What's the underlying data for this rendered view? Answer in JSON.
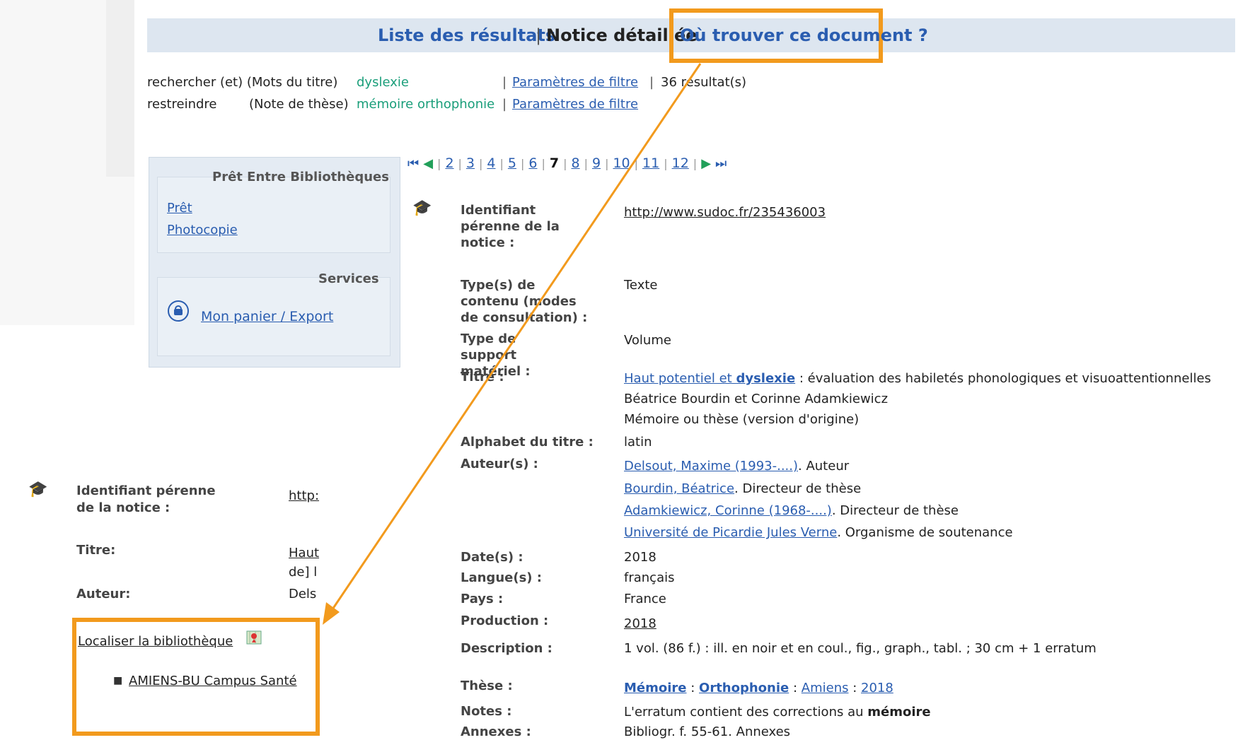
{
  "nav": {
    "results_list": "Liste des résultats",
    "separator": "|",
    "detailed": "Notice détaillée",
    "where_to_find": "Où trouver ce document ?"
  },
  "criteria": [
    {
      "op": "rechercher (et)",
      "field": "(Mots du titre)",
      "value": "dyslexie",
      "filter": "Paramètres de filtre",
      "extra": "36 résultat(s)"
    },
    {
      "op": "restreindre",
      "field": "(Note de thèse)",
      "value": "mémoire orthophonie",
      "filter": "Paramètres de filtre",
      "extra": ""
    }
  ],
  "pagination": [
    "2",
    "3",
    "4",
    "5",
    "6",
    "7",
    "8",
    "9",
    "10",
    "11",
    "12"
  ],
  "pagination_current": "7",
  "peb": {
    "title": "Prêt Entre Bibliothèques",
    "links": [
      "Prêt",
      "Photocopie"
    ]
  },
  "services": {
    "title": "Services",
    "link": "Mon panier / Export"
  },
  "record": {
    "id_label": "Identifiant pérenne de la notice :",
    "id_value": "http://www.sudoc.fr/235436003",
    "type_label": "Type(s) de contenu (modes de consultation) :",
    "type_value": "Texte",
    "support_label": "Type de support matériel :",
    "support_value": "Volume",
    "title_label": "Titre :",
    "title_link_a": "Haut potentiel et ",
    "title_link_b": "dyslexie",
    "title_rest": " : évaluation des habiletés phonologiques et visuoattentionnelles",
    "title_line2": "Béatrice Bourdin et Corinne Adamkiewicz",
    "title_line3": "Mémoire ou thèse (version d'origine)",
    "alphabet_label": "Alphabet du titre :",
    "alphabet_value": "latin",
    "authors_label": "Auteur(s) :",
    "authors": [
      {
        "name": "Delsout, Maxime (1993-....)",
        "role": ". Auteur"
      },
      {
        "name": "Bourdin, Béatrice",
        "role": ". Directeur de thèse"
      },
      {
        "name": "Adamkiewicz, Corinne (1968-....)",
        "role": ". Directeur de thèse"
      },
      {
        "name": "Université de Picardie Jules Verne",
        "role": ". Organisme de soutenance"
      }
    ],
    "date_label": "Date(s) :",
    "date_value": "2018",
    "lang_label": "Langue(s) :",
    "lang_value": "français",
    "country_label": "Pays :",
    "country_value": "France",
    "prod_label": "Production :",
    "prod_value": "2018",
    "desc_label": "Description :",
    "desc_value": "1 vol. (86 f.) : ill. en noir et en coul., fig., graph., tabl. ; 30 cm + 1 erratum",
    "these_label": "Thèse :",
    "these_parts": [
      "Mémoire",
      " : ",
      "Orthophonie",
      " : ",
      "Amiens",
      " : ",
      "2018"
    ],
    "notes_label": "Notes :",
    "notes_text": "L'erratum contient des corrections au ",
    "notes_bold": "mémoire",
    "annexes_label": "Annexes :",
    "annexes_value": "Bibliogr. f. 55-61. Annexes"
  },
  "mini": {
    "id_label_1": "Identifiant pérenne",
    "id_label_2": "de la notice :",
    "id_value": "http:",
    "title_label": "Titre:",
    "title_v1": "Haut",
    "title_v2": "de] l",
    "author_label": "Auteur:",
    "author_value": "Dels",
    "localize": "Localiser la bibliothèque",
    "library": "AMIENS-BU Campus Santé"
  },
  "colors": {
    "highlight": "#f29a1d",
    "link": "#2a5db0",
    "bar": "#dde6f0",
    "criteria_value": "#1a9e7a"
  }
}
